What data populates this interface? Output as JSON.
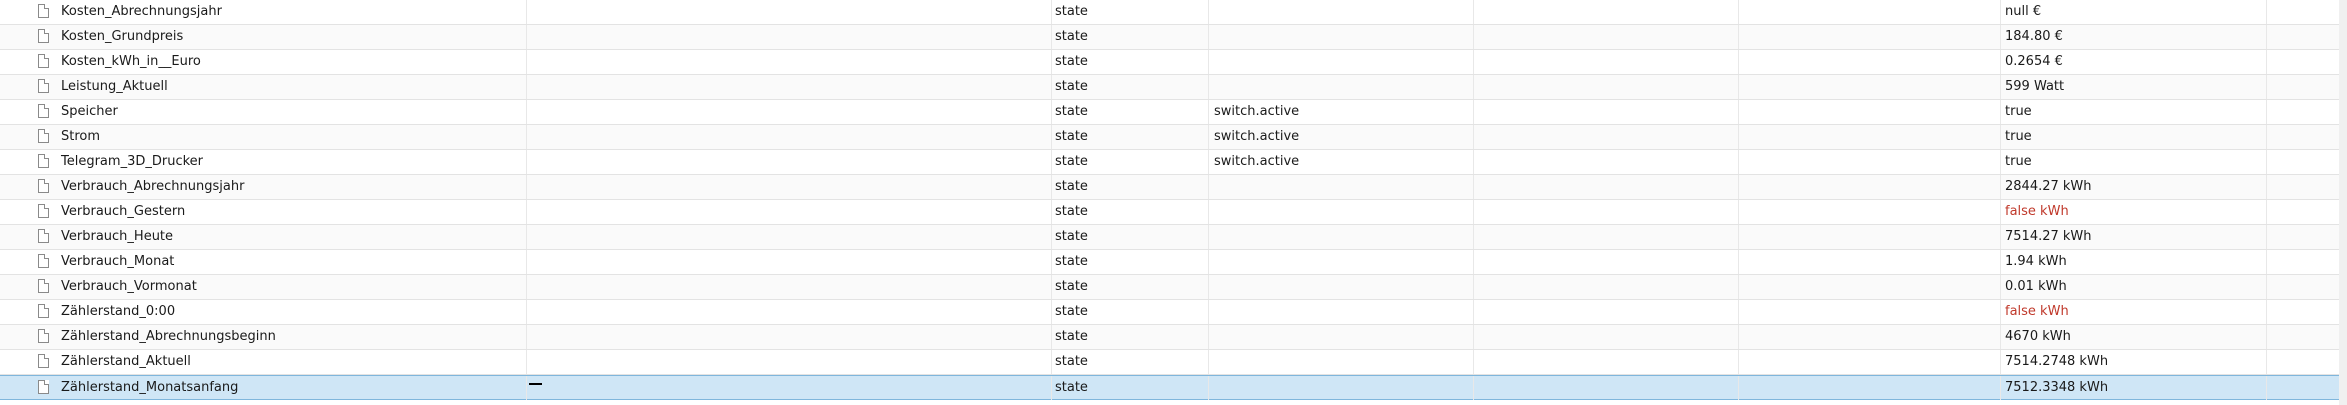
{
  "icons": {
    "file": "file-icon",
    "script": "script-icon",
    "edit": "pencil-icon",
    "delete": "trash-icon",
    "settings": "wrench-icon"
  },
  "colors": {
    "false_value": "#c0392b",
    "selected_row": "#cfe6f6"
  },
  "rows": [
    {
      "name": "Kosten_Abrechnungsjahr",
      "id": "Kosten_Abrechnungsjahr",
      "type": "state",
      "role": "",
      "value": "null €",
      "value_false": false,
      "selected": false
    },
    {
      "name": "Kosten_Grundpreis",
      "id": "Kosten_Grundpreis",
      "type": "state",
      "role": "",
      "value": "184.80 €",
      "value_false": false,
      "selected": false
    },
    {
      "name": "Kosten_kWh_in__Euro",
      "id": "Kosten_kWh_in _Euro",
      "type": "state",
      "role": "",
      "value": "0.2654 €",
      "value_false": false,
      "selected": false
    },
    {
      "name": "Leistung_Aktuell",
      "id": "Leistung_Aktuell",
      "type": "state",
      "role": "",
      "value": "599 Watt",
      "value_false": false,
      "selected": false
    },
    {
      "name": "Speicher",
      "id": "scriptEnabled.common.Speicher",
      "type": "state",
      "role": "switch.active",
      "value": "true",
      "value_false": false,
      "selected": false
    },
    {
      "name": "Strom",
      "id": "scriptEnabled.common.Strom",
      "type": "state",
      "role": "switch.active",
      "value": "true",
      "value_false": false,
      "selected": false
    },
    {
      "name": "Telegram_3D_Drucker",
      "id": "scriptEnabled.common.Telegram_3D_Drucker",
      "type": "state",
      "role": "switch.active",
      "value": "true",
      "value_false": false,
      "selected": false
    },
    {
      "name": "Verbrauch_Abrechnungsjahr",
      "id": "Verbrauch_Abrechnungsjahr",
      "type": "state",
      "role": "",
      "value": "2844.27 kWh",
      "value_false": false,
      "selected": false
    },
    {
      "name": "Verbrauch_Gestern",
      "id": "Verbrauch_Gestern",
      "type": "state",
      "role": "",
      "value": "false kWh",
      "value_false": true,
      "selected": false
    },
    {
      "name": "Verbrauch_Heute",
      "id": "Verbrauch_Heute",
      "type": "state",
      "role": "",
      "value": "7514.27 kWh",
      "value_false": false,
      "selected": false
    },
    {
      "name": "Verbrauch_Monat",
      "id": "Verbrauch_Monat",
      "type": "state",
      "role": "",
      "value": "1.94 kWh",
      "value_false": false,
      "selected": false
    },
    {
      "name": "Verbrauch_Vormonat",
      "id": "Verbrauch_Vormonat",
      "type": "state",
      "role": "",
      "value": "0.01 kWh",
      "value_false": false,
      "selected": false
    },
    {
      "name": "Zählerstand_0:00",
      "id": "Zählerstand_0:00",
      "type": "state",
      "role": "",
      "value": "false kWh",
      "value_false": true,
      "selected": false
    },
    {
      "name": "Zählerstand_Abrechnungsbeginn",
      "id": "Zählerstand_Abrechnungsbeginn",
      "type": "state",
      "role": "",
      "value": "4670 kWh",
      "value_false": false,
      "selected": false
    },
    {
      "name": "Zählerstand_Aktuell",
      "id": "Zählerstand_Aktuell",
      "type": "state",
      "role": "",
      "value": "7514.2748 kWh",
      "value_false": false,
      "selected": false
    },
    {
      "name": "Zählerstand_Monatsanfang",
      "id": "Zählerstand_Monatsanfang",
      "type": "state",
      "role": "",
      "value": "7512.3348 kWh",
      "value_false": false,
      "selected": true
    }
  ]
}
